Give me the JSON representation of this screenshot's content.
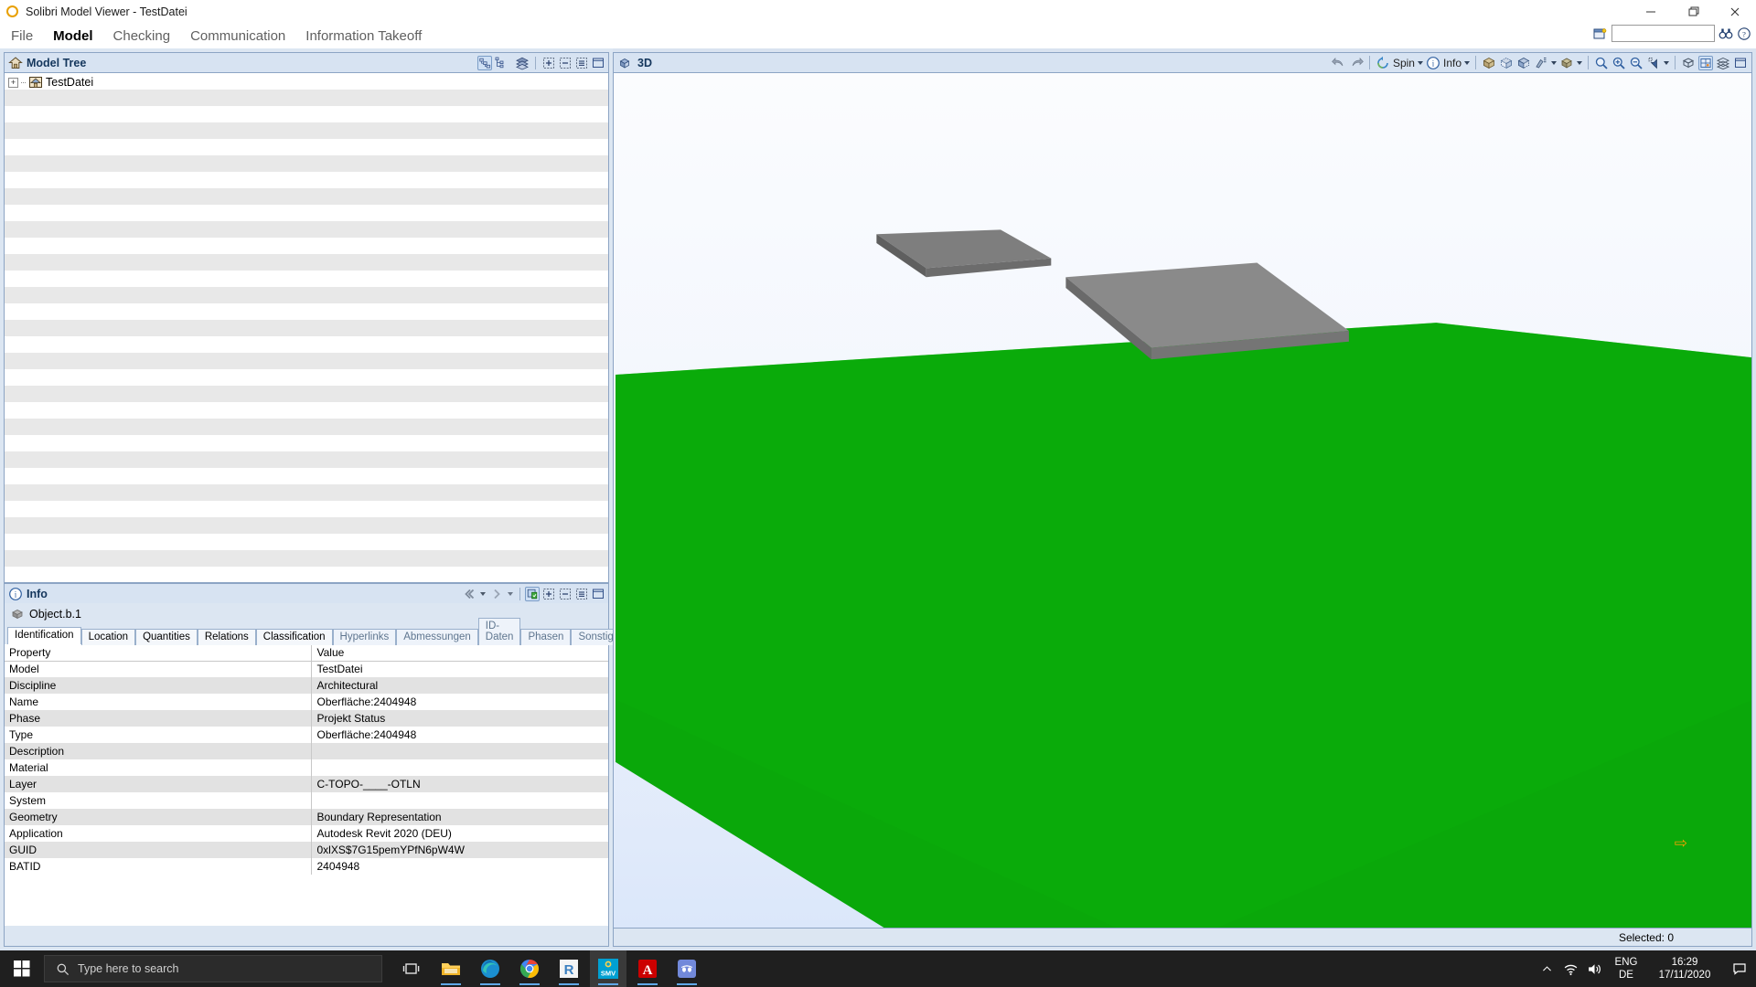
{
  "window": {
    "title": "Solibri Model Viewer - TestDatei",
    "logo": "circle-logo-icon",
    "controls": {
      "minimize": "–",
      "maximize": "❐",
      "close": "✕"
    }
  },
  "menu": {
    "items": [
      {
        "label": "File",
        "active": false
      },
      {
        "label": "Model",
        "active": true
      },
      {
        "label": "Checking",
        "active": false
      },
      {
        "label": "Communication",
        "active": false
      },
      {
        "label": "Information Takeoff",
        "active": false
      }
    ],
    "search_value": "",
    "search_placeholder": "",
    "icons": [
      "new-window-icon",
      "binoculars-icon",
      "help-icon"
    ]
  },
  "model_tree": {
    "title": "Model Tree",
    "header_icon": "house-icon",
    "toolbar": [
      "hierarchy-icon",
      "list-icon",
      "layers-icon",
      "expand-all-icon",
      "collapse-all-icon",
      "detail-icon",
      "maximize-panel-icon"
    ],
    "root_node": {
      "label": "TestDatei",
      "icon": "model-house-icon",
      "expander": "+"
    }
  },
  "info": {
    "title": "Info",
    "header_icon": "info-circle-icon",
    "object_label": "Object.b.1",
    "object_icon": "object-icon",
    "nav_icons": [
      "prev-icon",
      "prev-dropdown-icon",
      "next-icon",
      "next-dropdown-icon",
      "refresh-green-icon",
      "expand-all-icon",
      "collapse-all-icon",
      "detail-icon",
      "maximize-panel-icon"
    ],
    "tabs": [
      {
        "label": "Identification",
        "active": true,
        "enabled": true
      },
      {
        "label": "Location",
        "active": false,
        "enabled": true
      },
      {
        "label": "Quantities",
        "active": false,
        "enabled": true
      },
      {
        "label": "Relations",
        "active": false,
        "enabled": true
      },
      {
        "label": "Classification",
        "active": false,
        "enabled": true
      },
      {
        "label": "Hyperlinks",
        "active": false,
        "enabled": false
      },
      {
        "label": "Abmessungen",
        "active": false,
        "enabled": false
      },
      {
        "label": "ID-Daten",
        "active": false,
        "enabled": false
      },
      {
        "label": "Phasen",
        "active": false,
        "enabled": false
      },
      {
        "label": "Sonstige",
        "active": false,
        "enabled": false
      }
    ],
    "table": {
      "headers": [
        "Property",
        "Value"
      ],
      "rows": [
        {
          "property": "Model",
          "value": "TestDatei"
        },
        {
          "property": "Discipline",
          "value": "Architectural"
        },
        {
          "property": "Name",
          "value": "Oberfläche:2404948"
        },
        {
          "property": "Phase",
          "value": "Projekt Status"
        },
        {
          "property": "Type",
          "value": "Oberfläche:2404948"
        },
        {
          "property": "Description",
          "value": ""
        },
        {
          "property": "Material",
          "value": ""
        },
        {
          "property": "Layer",
          "value": "C-TOPO-____-OTLN"
        },
        {
          "property": "System",
          "value": ""
        },
        {
          "property": "Geometry",
          "value": "Boundary Representation"
        },
        {
          "property": "Application",
          "value": "Autodesk Revit 2020 (DEU)"
        },
        {
          "property": "GUID",
          "value": "0xlXS$7G15pemYPfN6pW4W"
        },
        {
          "property": "BATID",
          "value": "2404948"
        }
      ]
    }
  },
  "view": {
    "tab_label": "3D",
    "tab_icon": "cube-icon",
    "toolbar": {
      "back": "back-arrow-icon",
      "forward": "forward-arrow-icon",
      "spin_label": "Spin",
      "spin_icon": "spin-icon",
      "info_label": "Info",
      "info_icon": "info-circle-icon",
      "items": [
        "solid-cube-icon",
        "transparent-cube-icon",
        "wireframe-cube-icon",
        "paint-icon",
        "render-cube-icon",
        "zoom-area-icon",
        "zoom-in-icon",
        "zoom-out-icon",
        "select-arrow-icon",
        "fit-view-icon",
        "section-icon",
        "layers-icon",
        "maximize-panel-icon"
      ]
    },
    "status": "Selected: 0",
    "marker_icon": "orange-arrow-icon",
    "colors": {
      "terrain_green": "#0aa80a",
      "terrain_green_dark": "#0b8f0b",
      "slab_gray": "#7e7e7e",
      "slab_gray_dark": "#6a6a6a",
      "slab_gray_light": "#9a9a9a",
      "background_top": "#fbfcfe",
      "background_bottom": "#dbe7fa"
    }
  },
  "taskbar": {
    "start_icon": "windows-start-icon",
    "search_placeholder": "Type here to search",
    "search_icon": "search-icon",
    "taskview_icon": "task-view-icon",
    "apps": [
      {
        "name": "file-explorer-icon",
        "active": false
      },
      {
        "name": "microsoft-edge-icon",
        "active": false
      },
      {
        "name": "google-chrome-icon",
        "active": false
      },
      {
        "name": "rstudio-icon",
        "active": false
      },
      {
        "name": "solibri-model-viewer-icon",
        "active": true
      },
      {
        "name": "adobe-acrobat-icon",
        "active": false
      },
      {
        "name": "discord-icon",
        "active": false
      }
    ],
    "tray": {
      "chevron_icon": "show-hidden-icons-icon",
      "network_icon": "wifi-icon",
      "volume_icon": "speaker-icon",
      "language_line1": "ENG",
      "language_line2": "DE",
      "time": "16:29",
      "date": "17/11/2020",
      "action_center_icon": "action-center-icon"
    }
  }
}
